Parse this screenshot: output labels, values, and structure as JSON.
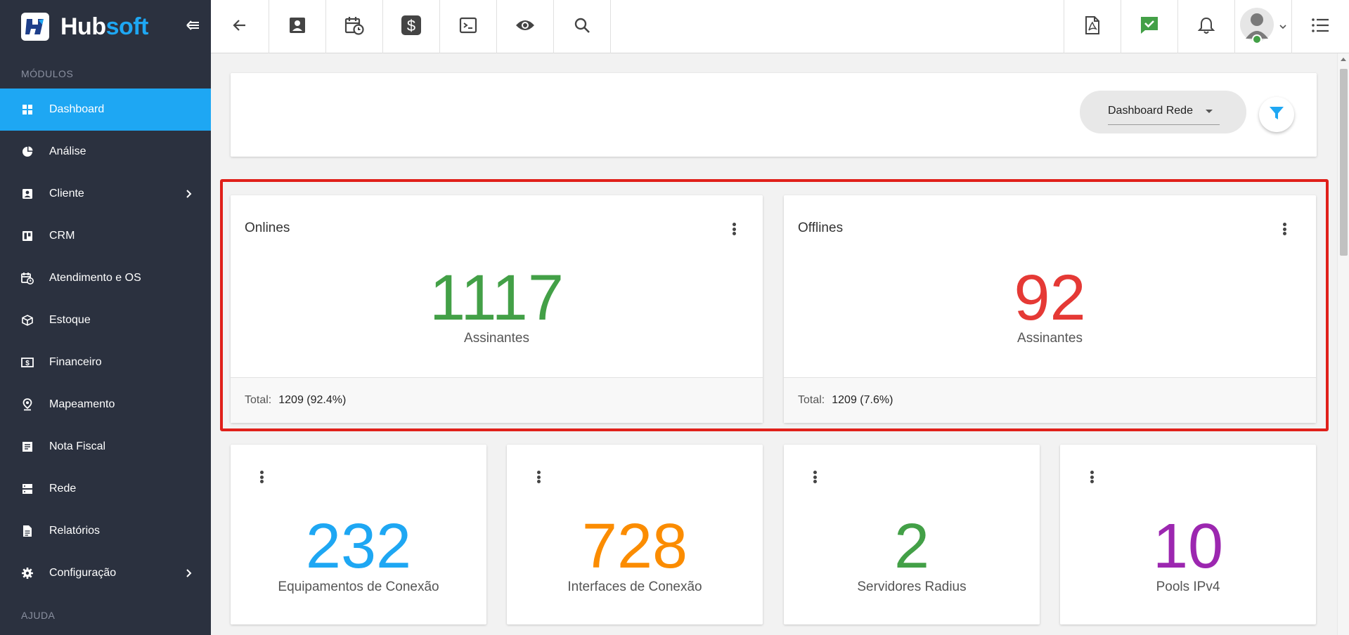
{
  "brand": {
    "name_part1": "Hub",
    "name_part2": "soft"
  },
  "sidebar": {
    "section_modulos": "MÓDULOS",
    "section_ajuda": "AJUDA",
    "items": [
      {
        "label": "Dashboard",
        "icon": "dashboard-icon",
        "active": true
      },
      {
        "label": "Análise",
        "icon": "pie-chart-icon"
      },
      {
        "label": "Cliente",
        "icon": "contact-card-icon",
        "has_submenu": true
      },
      {
        "label": "CRM",
        "icon": "trello-board-icon"
      },
      {
        "label": "Atendimento e OS",
        "icon": "calendar-clock-icon"
      },
      {
        "label": "Estoque",
        "icon": "cube-icon"
      },
      {
        "label": "Financeiro",
        "icon": "dollar-bill-icon"
      },
      {
        "label": "Mapeamento",
        "icon": "map-pin-icon"
      },
      {
        "label": "Nota Fiscal",
        "icon": "receipt-icon"
      },
      {
        "label": "Rede",
        "icon": "server-icon"
      },
      {
        "label": "Relatórios",
        "icon": "document-icon"
      },
      {
        "label": "Configuração",
        "icon": "gear-icon",
        "has_submenu": true
      }
    ]
  },
  "topbar": {
    "left_icons": [
      "back-arrow-icon",
      "contact-card-icon",
      "calendar-clock-icon",
      "dollar-icon",
      "terminal-icon",
      "eye-icon",
      "search-icon"
    ],
    "right_icons": [
      "pdf-icon",
      "check-message-icon",
      "bell-icon",
      "user-avatar",
      "list-icon"
    ]
  },
  "filter": {
    "dashboard_select": "Dashboard Rede"
  },
  "stats": {
    "online": {
      "title": "Onlines",
      "value": "1117",
      "subtitle": "Assinantes",
      "total_label": "Total:",
      "total_value": "1209 (92.4%)",
      "color": "#43a047"
    },
    "offline": {
      "title": "Offlines",
      "value": "92",
      "subtitle": "Assinantes",
      "total_label": "Total:",
      "total_value": "1209 (7.6%)",
      "color": "#e53935"
    }
  },
  "small_stats": [
    {
      "value": "232",
      "label": "Equipamentos de Conexão",
      "color": "#1ea7f3"
    },
    {
      "value": "728",
      "label": "Interfaces de Conexão",
      "color": "#fb8c00"
    },
    {
      "value": "2",
      "label": "Servidores Radius",
      "color": "#43a047"
    },
    {
      "value": "10",
      "label": "Pools IPv4",
      "color": "#9c27b0"
    }
  ],
  "colors": {
    "accent": "#1ea7f3",
    "sidebar_bg": "#2b313f",
    "highlight": "#e0201a"
  }
}
